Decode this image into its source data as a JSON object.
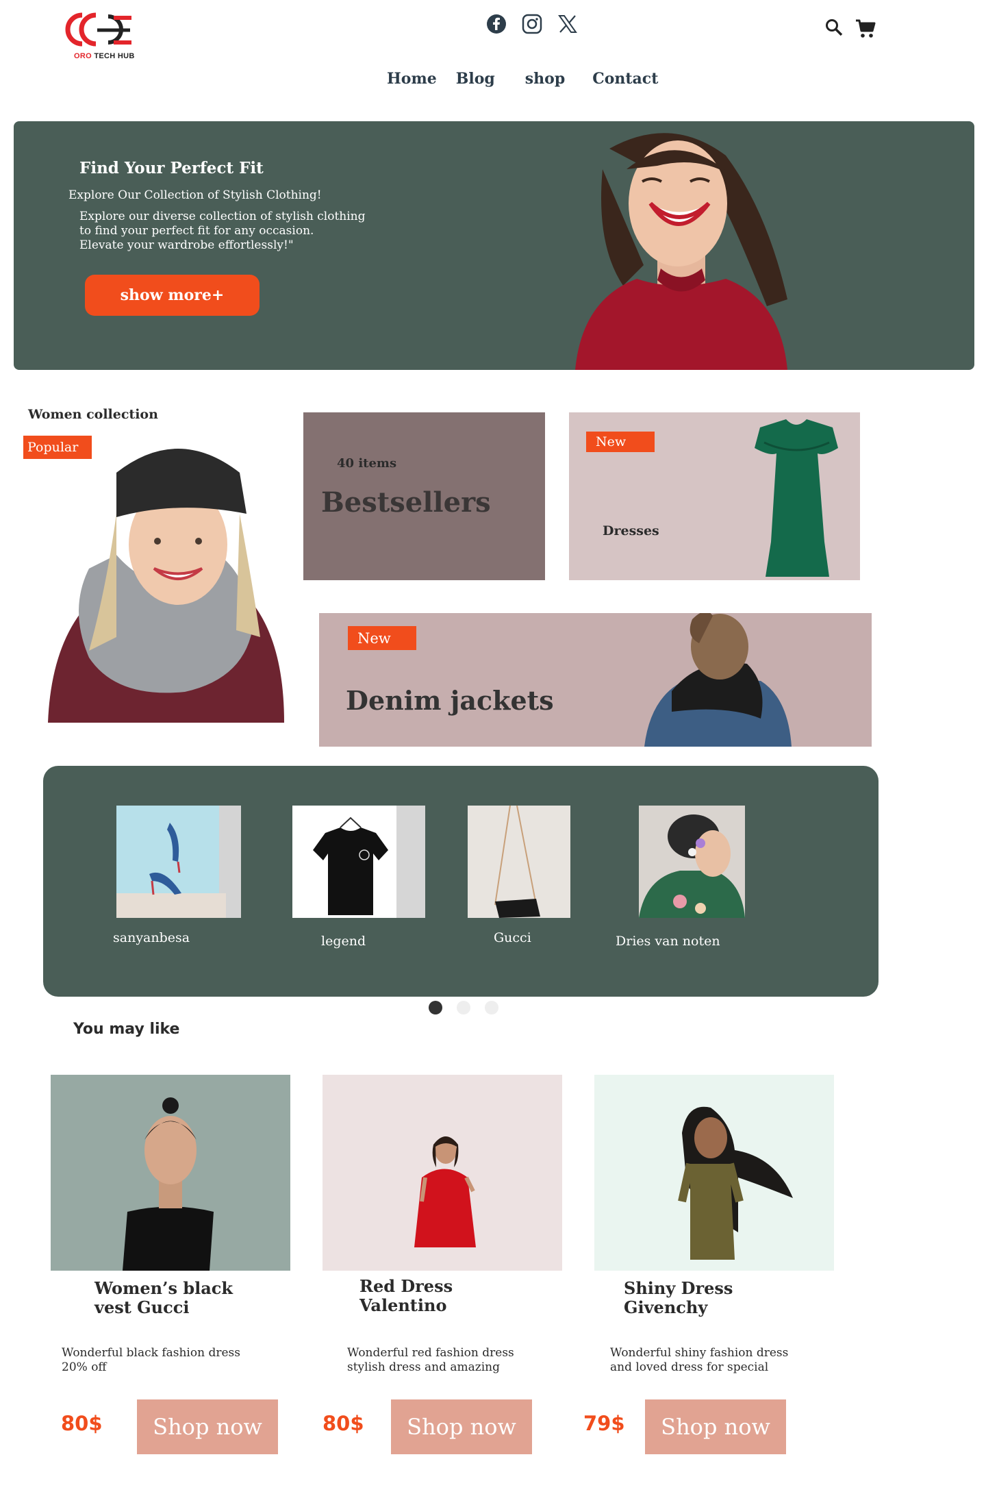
{
  "brand": {
    "logo_mark": "OC",
    "name_red": "ORO",
    "name_dark": "TECH HUB",
    "accent_color": "#f14d1c"
  },
  "header": {
    "social_icons": [
      "facebook-icon",
      "instagram-icon",
      "x-icon"
    ],
    "tool_icons": [
      "search-icon",
      "cart-icon"
    ],
    "nav": [
      "Home",
      "Blog",
      "shop",
      "Contact"
    ]
  },
  "hero": {
    "title": "Find Your Perfect Fit",
    "subtitle": "Explore Our Collection of Stylish Clothing!",
    "body": "Explore our diverse collection of stylish clothing\n to find your perfect fit for any occasion.\nElevate your wardrobe effortlessly!\"",
    "button": "show more+",
    "bg_color": "#4a5e57"
  },
  "collection": {
    "title": "Women collection",
    "popular_badge": "Popular",
    "bestsellers": {
      "count": "40 items",
      "title": "Bestsellers"
    },
    "dresses": {
      "badge": "New",
      "title": "Dresses"
    },
    "denim": {
      "badge": "New",
      "title": "Denim jackets"
    }
  },
  "brands": {
    "items": [
      "sanyanbesa",
      "legend",
      "Gucci",
      "Dries van noten"
    ],
    "pagination": {
      "pages": 3,
      "active": 1
    }
  },
  "you_may_like": {
    "title": "You may like",
    "products": [
      {
        "title": "Women’s black\nvest Gucci",
        "desc": "Wonderful black fashion dress\n20% off",
        "price": "80$",
        "button": "Shop now"
      },
      {
        "title": "Red Dress\nValentino",
        "desc": "Wonderful red fashion dress\nstylish dress  and amazing",
        "price": "80$",
        "button": "Shop now"
      },
      {
        "title": "Shiny Dress\nGivenchy",
        "desc": "Wonderful shiny fashion dress\n and loved dress for special",
        "price": "79$",
        "button": "Shop now"
      }
    ]
  }
}
